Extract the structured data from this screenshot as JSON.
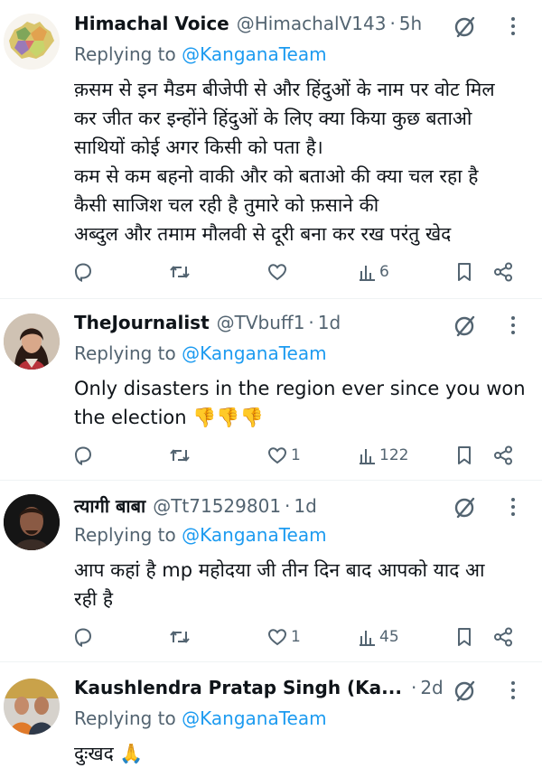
{
  "tweets": [
    {
      "name": "Himachal Voice",
      "handle": "@HimachalV143",
      "time": "5h",
      "replying_prefix": "Replying to",
      "replying_to": "@KanganaTeam",
      "lines": [
        "क़सम से इन मैडम बीजेपी से और हिंदुओं के नाम पर वोट मिल",
        "कर जीत कर इन्होंने हिंदुओं के लिए क्या किया कुछ बताओ",
        "साथियों कोई अगर किसी को पता है।",
        "कम से कम बहनो वाकी और को बताओ की क्या चल रहा है",
        "कैसी साजिश चल रही है तुमारे को फ़साने की",
        "अब्दुल और तमाम मौलवी से दूरी बना कर रख परंतु खेद"
      ],
      "replies": "",
      "reposts": "",
      "likes": "",
      "views": "6"
    },
    {
      "name": "TheJournalist",
      "handle": "@TVbuff1",
      "time": "1d",
      "replying_prefix": "Replying to",
      "replying_to": "@KanganaTeam",
      "lines": [
        "Only disasters in the region ever since you won",
        "the election 👎👎👎"
      ],
      "replies": "",
      "reposts": "",
      "likes": "1",
      "views": "122"
    },
    {
      "name": "त्यागी बाबा",
      "handle": "@Tt71529801",
      "time": "1d",
      "replying_prefix": "Replying to",
      "replying_to": "@KanganaTeam",
      "lines": [
        "आप कहां है mp महोदया जी तीन दिन बाद आपको याद आ",
        "रही है"
      ],
      "replies": "",
      "reposts": "",
      "likes": "1",
      "views": "45"
    },
    {
      "name": "Kaushlendra Pratap Singh (Ka...",
      "handle": "",
      "time": "2d",
      "replying_prefix": "Replying to",
      "replying_to": "@KanganaTeam",
      "lines": [
        "दुःखद 🙏"
      ]
    }
  ],
  "icons": {
    "reply": "reply-icon",
    "repost": "repost-icon",
    "like": "like-icon",
    "views": "views-icon",
    "bookmark": "bookmark-icon",
    "share": "share-icon",
    "grok": "grok-icon",
    "more": "more-icon"
  },
  "colors": {
    "text": "#0f1419",
    "secondary": "#536471",
    "link": "#1d9bf0",
    "divider": "#eff3f4"
  }
}
